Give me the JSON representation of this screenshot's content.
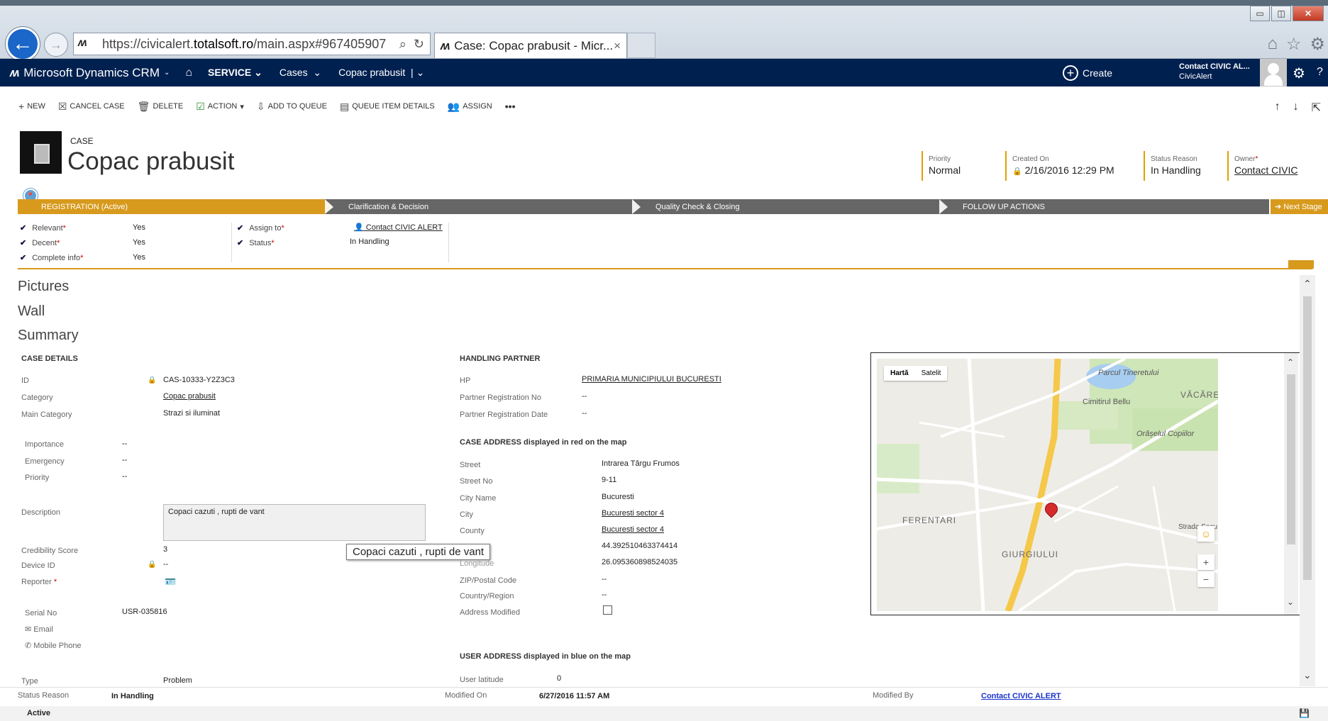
{
  "browser": {
    "url_prefix": "https://civicalert.",
    "url_host": "totalsoft.ro",
    "url_suffix": "/main.aspx#967405907",
    "tab_title": "Case: Copac prabusit - Micr...",
    "tab_close": "×"
  },
  "nav": {
    "brand": "Microsoft Dynamics CRM",
    "area": "SERVICE",
    "entity": "Cases",
    "record": "Copac prabusit",
    "create": "Create",
    "user_name": "Contact CIVIC AL...",
    "user_org": "CivicAlert"
  },
  "commands": [
    {
      "label": "NEW",
      "icon": "+"
    },
    {
      "label": "CANCEL CASE",
      "icon": "☒"
    },
    {
      "label": "DELETE",
      "icon": "🗑"
    },
    {
      "label": "ACTION",
      "icon": "☑"
    },
    {
      "label": "ADD TO QUEUE",
      "icon": "⇩"
    },
    {
      "label": "QUEUE ITEM DETAILS",
      "icon": "▤"
    },
    {
      "label": "ASSIGN",
      "icon": "👥"
    },
    {
      "label": "•••",
      "icon": ""
    }
  ],
  "header": {
    "entity": "CASE",
    "title": "Copac prabusit",
    "fields": [
      {
        "label": "Priority",
        "value": "Normal"
      },
      {
        "label": "Created On",
        "value": "2/16/2016  12:29 PM"
      },
      {
        "label": "Status Reason",
        "value": "In Handling"
      },
      {
        "label": "Owner",
        "value": "Contact CIVIC"
      }
    ]
  },
  "process": {
    "stages": [
      "REGISTRATION (Active)",
      "Clarification & Decision",
      "Quality Check & Closing",
      "FOLLOW UP ACTIONS"
    ],
    "next": "Next Stage",
    "steps": [
      {
        "label": "Relevant",
        "value": "Yes"
      },
      {
        "label": "Decent",
        "value": "Yes"
      },
      {
        "label": "Complete info",
        "value": "Yes"
      },
      {
        "label": "Assign to",
        "value": "Contact CIVIC ALERT"
      },
      {
        "label": "Status",
        "value": "In Handling"
      }
    ]
  },
  "sections": [
    "Pictures",
    "Wall",
    "Summary"
  ],
  "case_details": {
    "heading": "CASE DETAILS",
    "id_label": "ID",
    "id": "CAS-10333-Y2Z3C3",
    "category_label": "Category",
    "category": "Copac prabusit",
    "main_category_label": "Main Category",
    "main_category": "Strazi si iluminat",
    "importance_label": "Importance",
    "importance": "--",
    "emergency_label": "Emergency",
    "emergency": "--",
    "priority_label": "Priority",
    "priority": "--",
    "description_label": "Description",
    "description": "Copaci cazuti , rupti de vant",
    "credibility_label": "Credibility Score",
    "credibility": "3",
    "device_label": "Device ID",
    "device": "--",
    "reporter_label": "Reporter",
    "serial_label": "Serial No",
    "serial": "USR-035816",
    "email_label": "Email",
    "mobile_label": "Mobile Phone",
    "type_label": "Type",
    "type": "Problem",
    "tooltip": "Copaci cazuti , rupti de vant"
  },
  "handling": {
    "heading": "HANDLING PARTNER",
    "hp_label": "HP",
    "hp": "PRIMARIA MUNICIPIULUI BUCURESTI",
    "reg_no_label": "Partner Registration No",
    "reg_no": "--",
    "reg_date_label": "Partner Registration Date",
    "reg_date": "--",
    "addr_heading": "CASE ADDRESS displayed in red on the map",
    "street_label": "Street",
    "street": "Intrarea Târgu Frumos",
    "street_no_label": "Street No",
    "street_no": "9-11",
    "city_name_label": "City Name",
    "city_name": "Bucuresti",
    "city_label": "City",
    "city": "Bucuresti sector 4",
    "county_label": "County",
    "county": "Bucuresti sector 4",
    "latitude": "44.392510463374414",
    "longitude_label": "Longitude",
    "longitude": "26.095360898524035",
    "zip_label": "ZIP/Postal Code",
    "zip": "--",
    "country_label": "Country/Region",
    "country": "--",
    "modified_label": "Address Modified",
    "user_heading": "USER ADDRESS displayed in blue on the map",
    "user_lat_label": "User latitude",
    "user_lat": "0"
  },
  "map": {
    "tab_map": "Hartă",
    "tab_sat": "Satelit",
    "labels": [
      "Parcul Tineretului",
      "Cimitirul Bellu",
      "VĂCĂRE",
      "Orășelul Copiilor",
      "FERENTARI",
      "GIURGIULUI",
      "Strada Secu"
    ]
  },
  "footer": {
    "status_reason_label": "Status Reason",
    "status_reason": "In Handling",
    "modified_on_label": "Modified On",
    "modified_on": "6/27/2016 11:57 AM",
    "modified_by_label": "Modified By",
    "modified_by": "Contact CIVIC ALERT",
    "status": "Active"
  }
}
